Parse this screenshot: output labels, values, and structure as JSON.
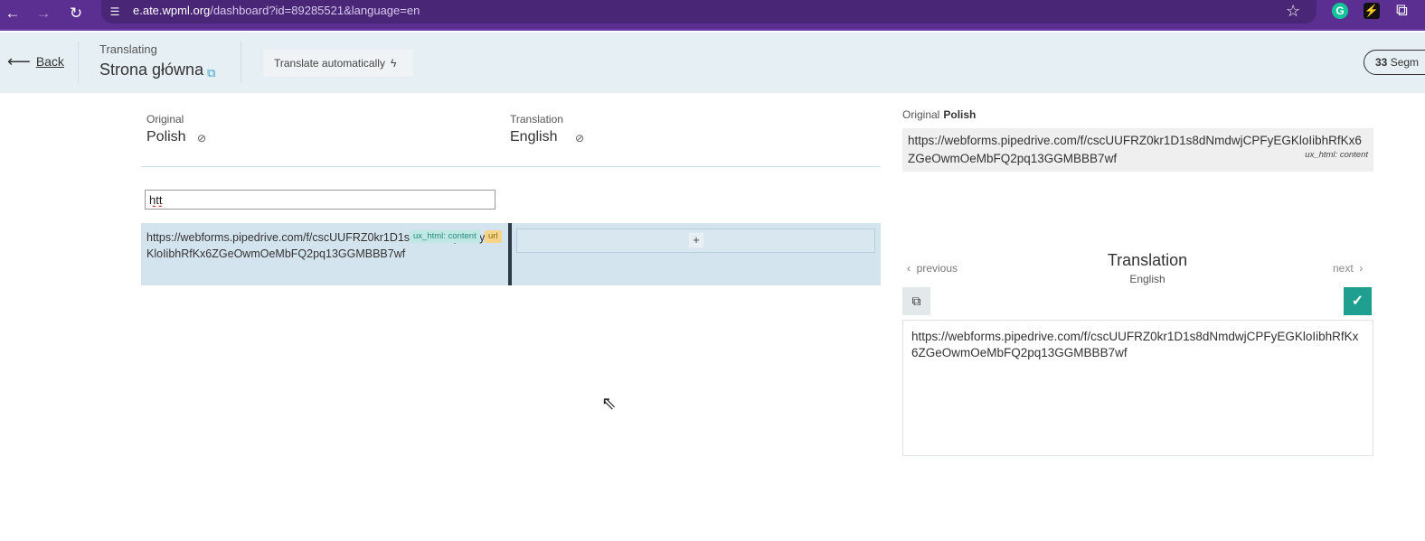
{
  "browser": {
    "url_host": "e.ate.wpml.org",
    "url_path": "/dashboard?id=89285521&language=en"
  },
  "header": {
    "back_label": "Back",
    "translating_label": "Translating",
    "page_title": "Strona główna",
    "translate_auto_label": "Translate automatically",
    "segments_count": "33",
    "segments_label": "Segm"
  },
  "columns": {
    "original_label": "Original",
    "original_lang": "Polish",
    "translation_label": "Translation",
    "translation_lang": "English"
  },
  "filter": {
    "value": "htt"
  },
  "segment": {
    "source_text": "https://webforms.pipedrive.com/f/cscUUFRZ0kr1D1s8dNmdwjCPFyEGKloIibhRfKx6ZGeOwmOeMbFQ2pq13GGMBBB7wf",
    "tag_ux": "ux_html: content",
    "tag_url": "url",
    "add_label": "+"
  },
  "right_panel": {
    "original_label": "Original",
    "original_lang": "Polish",
    "original_text": "https://webforms.pipedrive.com/f/cscUUFRZ0kr1D1s8dNmdwjCPFyEGKloIibhRfKx6ZGeOwmOeMbFQ2pq13GGMBBB7wf",
    "original_tag": "ux_html: content",
    "prev_label": "previous",
    "next_label": "next",
    "title": "Translation",
    "subtitle": "English",
    "translation_text": "https://webforms.pipedrive.com/f/cscUUFRZ0kr1D1s8dNmdwjCPFyEGKloIibhRfKx6ZGeOwmOeMbFQ2pq13GGMBBB7wf"
  },
  "colors": {
    "browser_bar": "#5b2f91",
    "header_bg": "#e6eff3",
    "segment_bg": "#d3e4ee",
    "save_button": "#1f9f8f"
  }
}
